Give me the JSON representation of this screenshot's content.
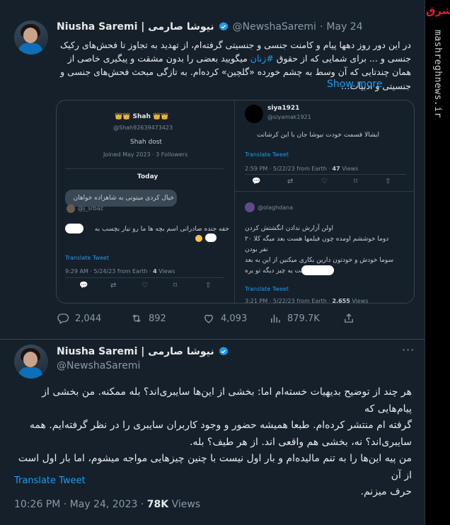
{
  "watermark": {
    "brand": "مشرق",
    "site": "mashreghnews.ir"
  },
  "tweet1": {
    "author_name": "Niusha Saremi | نیوشا صارمی",
    "handle": "@NewshaSaremi",
    "sep": "·",
    "date": "May 24",
    "text_before_link": "در این دور روز دهها پیام و کامنت جنسی و جنسیتی گرفته‌ام، از تهدید به تجاوز تا فحش‌های رکیک جنسی و ... برای شمایی که از حقوق ",
    "hashtag": "#زنان",
    "text_after_link": " میگویید بعضی را بدون مشقت و پیگیری خاصی از همان چندتایی که آن وسط به چشم خورده «گلچین» کرده‌ام. به تازگی مبحث فحش‌های جنسی و جنسیتی و ادبیات…",
    "show_more": "Show more",
    "media": {
      "left": {
        "crown_name": "👑👑 Shah 👑👑",
        "shah_handle": "@Shah92639473423",
        "bio": "Shah dost",
        "joined": "Joined May 2023 · 3 Followers",
        "today": "Today",
        "bubble_text": "خیال کردی میتونی به شاهزاده خواهان",
        "reply_handle": "@j_srbaz",
        "reply_text_1": "خفه جنده صادراتی اسم بچه ها ما رو نیار بچسب به",
        "translate": "Translate Tweet",
        "time": "9:29 AM · 5/24/23 from Earth · ",
        "views": "4",
        "views_label": "Views"
      },
      "right": {
        "name": "siya1921",
        "handle": "@siyamak1921",
        "text": "ایشالا قسمت خودت نیوشا جان با این کرشاتت",
        "translate": "Translate Tweet",
        "time": "2:59 PM · 5/22/23 from Earth · ",
        "views": "47",
        "views_label": "Views",
        "reply_handle": "@olaghdana",
        "reply_lines": [
          "اولن آزارش ندادن انگشتش کردن",
          "دوما خوششم اومده چون فیلمها هست بعد میگه کلا ۲۰",
          "نفر بودن",
          "سوما خودش و خودتون دارین بکاری میکنین از این به بعد",
          "بجا انگشت یه چیز دیگه تو       یره"
        ],
        "translate2": "Translate Tweet",
        "time2": "3:21 PM · 5/22/23 from Earth · ",
        "views2": "2,655",
        "views2_label": "Views"
      }
    },
    "stats": {
      "replies": "2,044",
      "retweets": "892",
      "likes": "4,093",
      "views": "879.7K"
    }
  },
  "tweet2": {
    "author_name": "Niusha Saremi | نیوشا صارمی",
    "handle": "@NewshaSaremi",
    "text_lines": [
      "هر چند از توضیح بدیهیات خسته‌ام اما: بخشی از این‌ها سایبری‌اند؟ بله ممکنه. من بخشی از پیام‌هایی که",
      "گرفته ام منتشر کرده‌ام. طبعا همیشه حضور و وجود کاربران سایبری را در نظر گرفته‌ایم. همه",
      "سایبری‌اند؟ نه، بخشی هم واقعی اند. از هر طیف؟ بله.",
      "من پیه این‌ها را به تنم مالیده‌ام و بار اول نیست با چنین چیزهایی مواجه میشوم، اما بار اول است از آن",
      "حرف میزنم."
    ],
    "translate": "Translate Tweet",
    "time": "10:26 PM · May 24, 2023 · ",
    "views": "78K",
    "views_label": "Views"
  },
  "colors": {
    "background": "#15202b",
    "accent": "#1d9bf0",
    "text": "#e7e9ea",
    "muted": "#8b98a5",
    "verified": "#1d9bf0",
    "watermark": "#e11d2a"
  }
}
